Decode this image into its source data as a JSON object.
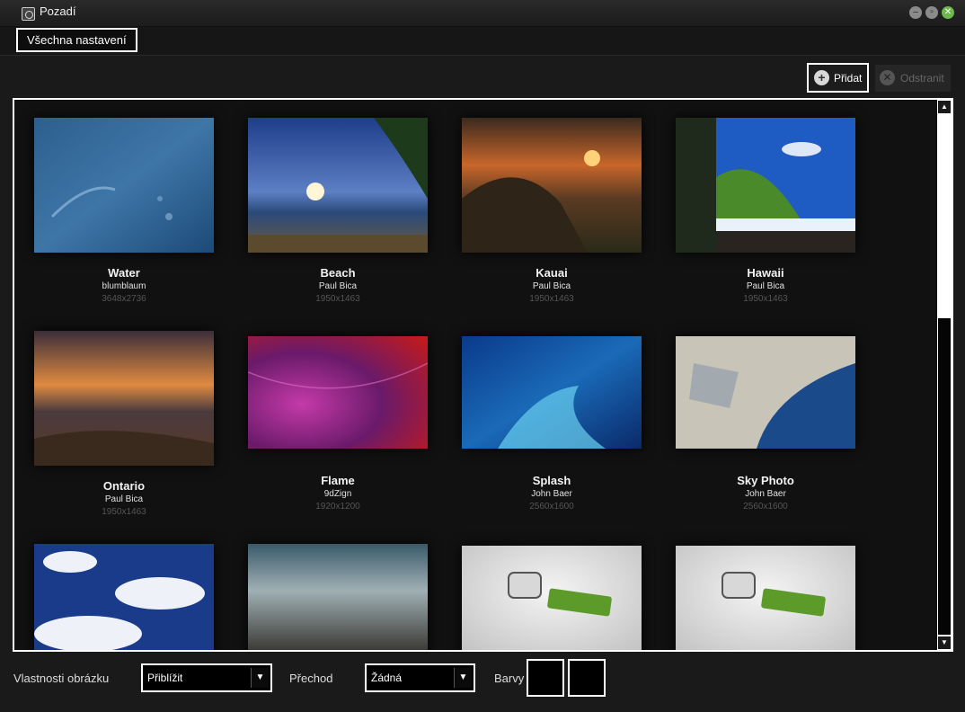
{
  "window": {
    "title": "Pozadí",
    "icon": "wallpaper-app-icon",
    "controls": [
      "minimize-icon",
      "maximize-icon",
      "close-icon"
    ]
  },
  "header": {
    "all_settings": "Všechna nastavení"
  },
  "toolbar": {
    "add_label": "Přidat",
    "add_icon": "plus-icon",
    "remove_label": "Odstranit",
    "remove_icon": "remove-icon",
    "remove_enabled": false
  },
  "wallpapers": [
    {
      "name": "Water",
      "author": "blumblaum",
      "size": "3648x2736"
    },
    {
      "name": "Beach",
      "author": "Paul Bica",
      "size": "1950x1463"
    },
    {
      "name": "Kauai",
      "author": "Paul Bica",
      "size": "1950x1463"
    },
    {
      "name": "Hawaii",
      "author": "Paul Bica",
      "size": "1950x1463"
    },
    {
      "name": "Ontario",
      "author": "Paul Bica",
      "size": "1950x1463"
    },
    {
      "name": "Flame",
      "author": "9dZign",
      "size": "1920x1200"
    },
    {
      "name": "Splash",
      "author": "John Baer",
      "size": "2560x1600"
    },
    {
      "name": "Sky Photo",
      "author": "John Baer",
      "size": "2560x1600"
    },
    {
      "name": "",
      "author": "",
      "size": ""
    },
    {
      "name": "",
      "author": "",
      "size": ""
    },
    {
      "name": "",
      "author": "",
      "size": ""
    },
    {
      "name": "",
      "author": "",
      "size": ""
    }
  ],
  "bottom": {
    "picture_options_label": "Vlastnosti obrázku",
    "picture_options_value": "Přiblížit",
    "transition_label": "Přechod",
    "transition_value": "Žádná",
    "colors_label": "Barvy",
    "primary_color": "#000000",
    "secondary_color": "#000000"
  },
  "colors": {
    "accent": "#6fb84f",
    "highlight_border": "#ffffff"
  }
}
